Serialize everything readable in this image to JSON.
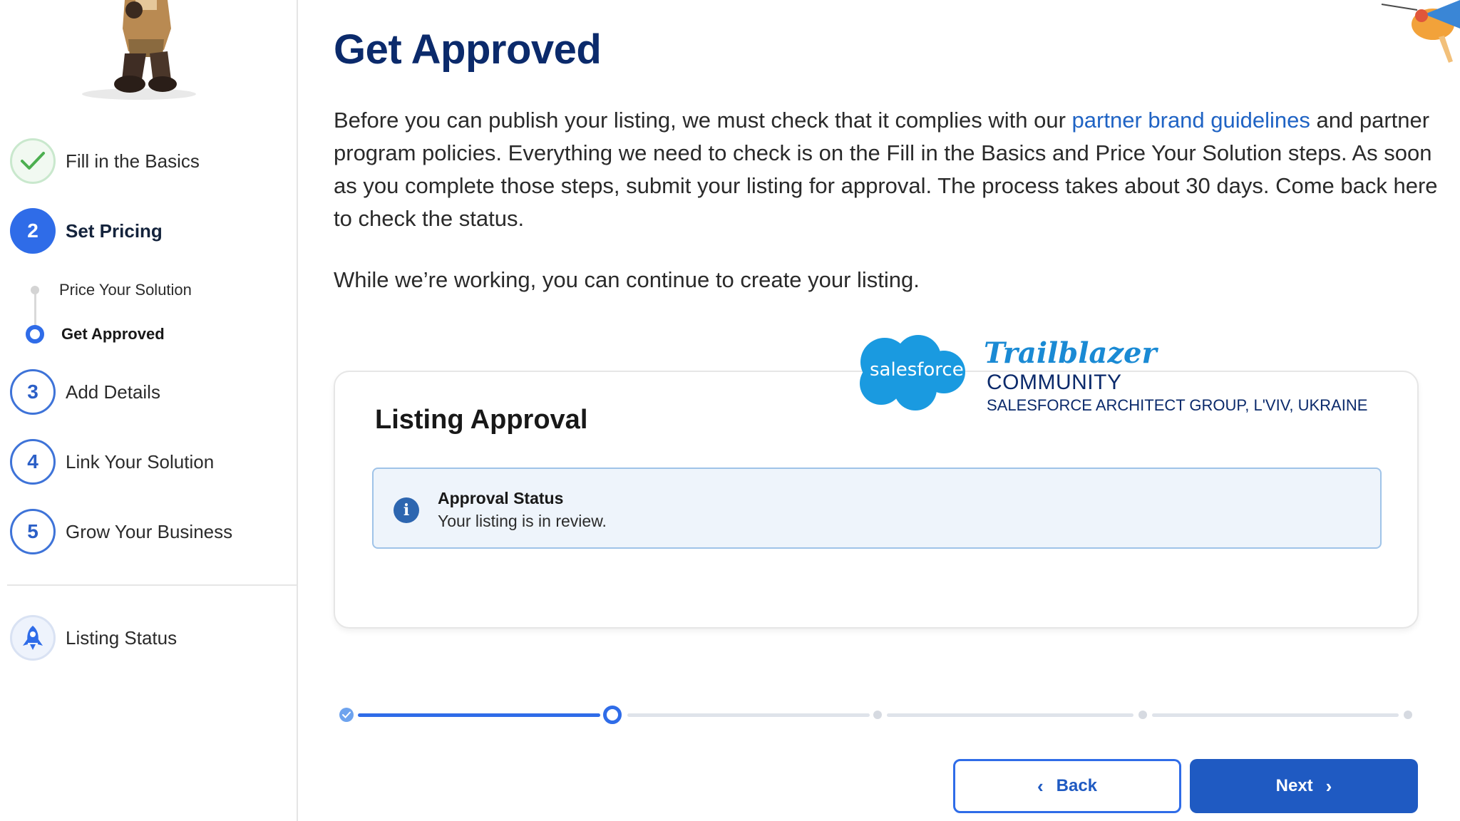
{
  "sidebar": {
    "steps": [
      {
        "label": "Fill in the Basics",
        "state": "done",
        "icon": "check-icon"
      },
      {
        "label": "Set Pricing",
        "state": "active",
        "number": "2"
      },
      {
        "label": "Add Details",
        "state": "todo",
        "number": "3"
      },
      {
        "label": "Link Your Solution",
        "state": "todo",
        "number": "4"
      },
      {
        "label": "Grow Your Business",
        "state": "todo",
        "number": "5"
      }
    ],
    "substeps": [
      {
        "label": "Price Your Solution",
        "state": "todo"
      },
      {
        "label": "Get Approved",
        "state": "current"
      }
    ],
    "status": {
      "label": "Listing Status",
      "icon": "rocket-icon"
    }
  },
  "main": {
    "title": "Get Approved",
    "intro_before_link": "Before you can publish your listing, we must check that it complies with our ",
    "intro_link": "partner brand guidelines",
    "intro_after_link": " and partner program policies. Everything we need to check is on the Fill in the Basics and Price Your Solution steps. As soon as you complete those steps, submit your listing for approval. The process takes about 30 days. Come back here to check the status.",
    "working_text": "While we’re working, you can continue to create your listing."
  },
  "card": {
    "title": "Listing Approval",
    "alert": {
      "icon": "info-icon",
      "icon_glyph": "i",
      "title": "Approval Status",
      "text": "Your listing is in review."
    }
  },
  "watermark": {
    "logo_text": "salesforce",
    "script": "Trailblazer",
    "community": "COMMUNITY",
    "group": "SALESFORCE ARCHITECT GROUP, L'VIV, UKRAINE"
  },
  "progress": {
    "current_step": 2,
    "total_steps": 5
  },
  "buttons": {
    "back": "Back",
    "next": "Next"
  },
  "colors": {
    "primary": "#2f6ce8",
    "title": "#0b2a6b",
    "link": "#1f63c4",
    "success": "#4caf50"
  }
}
